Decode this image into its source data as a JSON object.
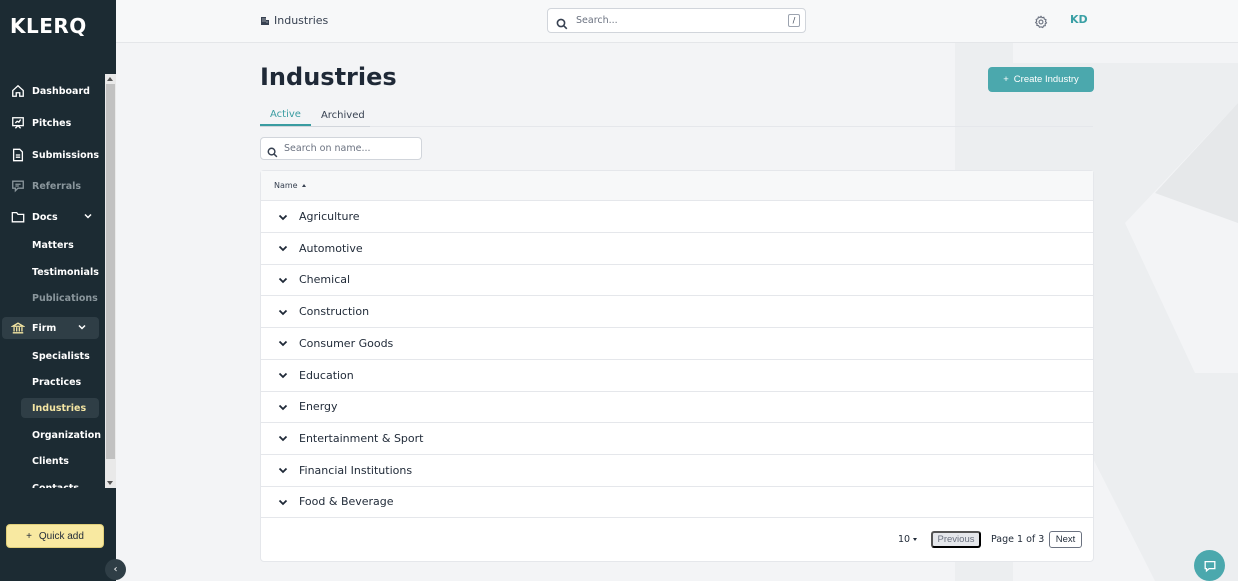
{
  "app": {
    "logo": "KLERQ"
  },
  "sidebar": {
    "items": [
      {
        "label": "Dashboard",
        "icon": "home-icon"
      },
      {
        "label": "Pitches",
        "icon": "presentation-icon"
      },
      {
        "label": "Submissions",
        "icon": "document-icon"
      },
      {
        "label": "Referrals",
        "icon": "chat-icon"
      },
      {
        "label": "Docs",
        "icon": "folder-icon"
      },
      {
        "label": "Firm",
        "icon": "bank-icon"
      }
    ],
    "docs_children": [
      "Matters",
      "Testimonials",
      "Publications"
    ],
    "firm_children": [
      "Specialists",
      "Practices",
      "Industries",
      "Organization",
      "Clients",
      "Contacts"
    ],
    "quick_add": "Quick add"
  },
  "header": {
    "breadcrumb": "Industries",
    "search_placeholder": "Search...",
    "search_shortcut": "/",
    "avatar_initials": "KD"
  },
  "main": {
    "title": "Industries",
    "create_button": "Create Industry",
    "tabs": [
      "Active",
      "Archived"
    ],
    "search_placeholder": "Search on name...",
    "table": {
      "column_name": "Name",
      "rows": [
        "Agriculture",
        "Automotive",
        "Chemical",
        "Construction",
        "Consumer Goods",
        "Education",
        "Energy",
        "Entertainment & Sport",
        "Financial Institutions",
        "Food & Beverage"
      ]
    },
    "pagination": {
      "per_page": "10",
      "previous": "Previous",
      "page_info": "Page 1 of 3",
      "next": "Next"
    }
  },
  "colors": {
    "sidebar_bg": "#1c2b33",
    "accent": "#4ba8ad",
    "quick_add_bg": "#f8e9a1",
    "active_sub_text": "#f5e6a3"
  }
}
